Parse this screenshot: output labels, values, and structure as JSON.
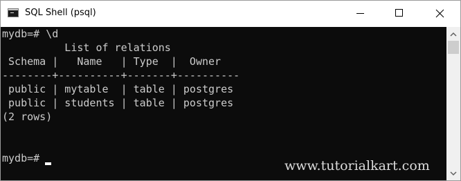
{
  "window": {
    "title": "SQL Shell (psql)",
    "icon": "terminal-icon"
  },
  "controls": {
    "minimize": "minimize-icon",
    "maximize": "maximize-icon",
    "close": "close-icon"
  },
  "console": {
    "lines": [
      "mydb=# \\d",
      "          List of relations",
      " Schema |   Name   | Type  |  Owner",
      "--------+----------+-------+----------",
      " public | mytable  | table | postgres",
      " public | students | table | postgres",
      "(2 rows)",
      "",
      "",
      "mydb=# "
    ]
  },
  "watermark": "www.tutorialkart.com",
  "colors": {
    "console_bg": "#0c0c0c",
    "console_text": "#cccccc",
    "titlebar_bg": "#ffffff"
  }
}
